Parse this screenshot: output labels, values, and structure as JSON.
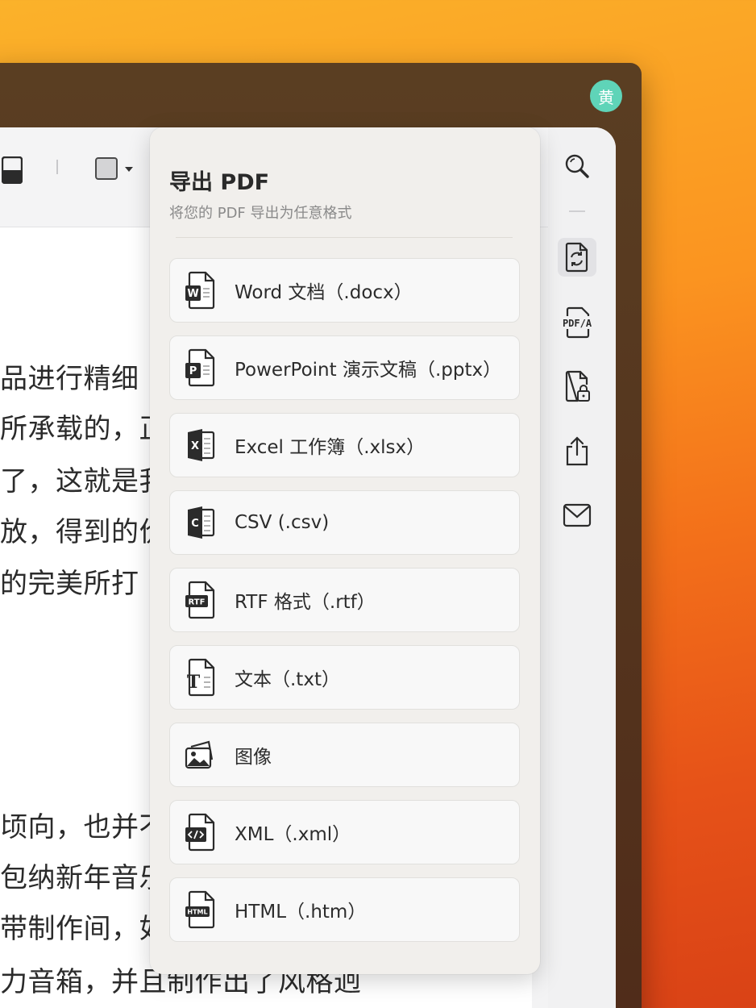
{
  "user": {
    "avatar_text": "黄"
  },
  "export_panel": {
    "title": "导出 PDF",
    "subtitle": "将您的 PDF 导出为任意格式",
    "items": [
      {
        "label": "Word 文档（.docx）",
        "icon": "word-file-icon"
      },
      {
        "label": "PowerPoint 演示文稿（.pptx）",
        "icon": "powerpoint-file-icon"
      },
      {
        "label": "Excel 工作簿（.xlsx）",
        "icon": "excel-file-icon"
      },
      {
        "label": "CSV (.csv)",
        "icon": "csv-file-icon"
      },
      {
        "label": "RTF 格式（.rtf）",
        "icon": "rtf-file-icon"
      },
      {
        "label": "文本（.txt）",
        "icon": "text-file-icon"
      },
      {
        "label": "图像",
        "icon": "image-icon"
      },
      {
        "label": "XML（.xml）",
        "icon": "xml-file-icon"
      },
      {
        "label": "HTML（.htm）",
        "icon": "html-file-icon"
      }
    ]
  },
  "icon_badges": {
    "pdfa": "PDF/A",
    "word": "W",
    "ppt": "P",
    "excel": "X",
    "csv": "C",
    "rtf": "RTF",
    "txt": "T",
    "html": "HTML"
  },
  "document": {
    "lines_top": [
      "品进行精细",
      "所承载的，正",
      "了，这就是我",
      "放，得到的价",
      "的完美所打"
    ],
    "lines_bottom": [
      "顷向，也并不",
      "包纳新年音乐",
      "带制作间，如",
      "力音箱，并且制作出了风格迥"
    ]
  },
  "right_rail": {
    "items": [
      "search-icon",
      "convert-icon",
      "pdfa-icon",
      "protect-icon",
      "share-icon",
      "mail-icon"
    ]
  },
  "colors": {
    "accent_avatar": "#5fd4b8",
    "panel_bg": "#f1efec",
    "window_bg": "#5a3e22"
  }
}
